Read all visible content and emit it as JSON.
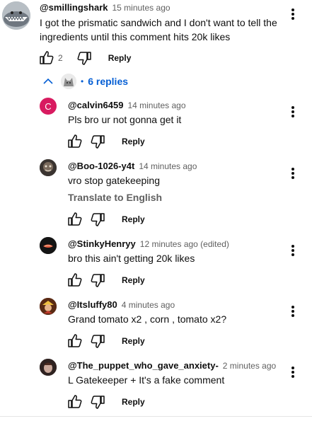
{
  "colors": {
    "link_blue": "#065fd4",
    "muted": "#606060",
    "text": "#0f0f0f",
    "avatar_c_bg": "#d81b60"
  },
  "top_comment": {
    "handle": "@smillingshark",
    "time": "15 minutes ago",
    "text": "I got the prismatic sandwich and I don't want to tell the ingredients until this comment hits 20k likes",
    "likes": "2",
    "reply_label": "Reply"
  },
  "replies_toggle": {
    "icon": "chevron-up-icon",
    "separator": "•",
    "label": "6 replies"
  },
  "replies": [
    {
      "handle": "@calvin6459",
      "time": "14 minutes ago",
      "text": "Pls bro ur not gonna get it",
      "reply_label": "Reply",
      "avatar_letter": "C"
    },
    {
      "handle": "@Boo-1026-y4t",
      "time": "14 minutes ago",
      "text": "vro stop gatekeeping",
      "translate": "Translate to English",
      "reply_label": "Reply"
    },
    {
      "handle": "@StinkyHenryy",
      "time": "12 minutes ago (edited)",
      "text": "bro this ain't getting 20k likes",
      "reply_label": "Reply"
    },
    {
      "handle": "@Itsluffy80",
      "time": "4 minutes ago",
      "text": "Grand tomato x2 , corn , tomato x2?",
      "reply_label": "Reply"
    },
    {
      "handle": "@The_puppet_who_gave_anxiety-",
      "time": "2 minutes ago",
      "text": "L Gatekeeper + It's a fake comment",
      "reply_label": "Reply"
    }
  ]
}
